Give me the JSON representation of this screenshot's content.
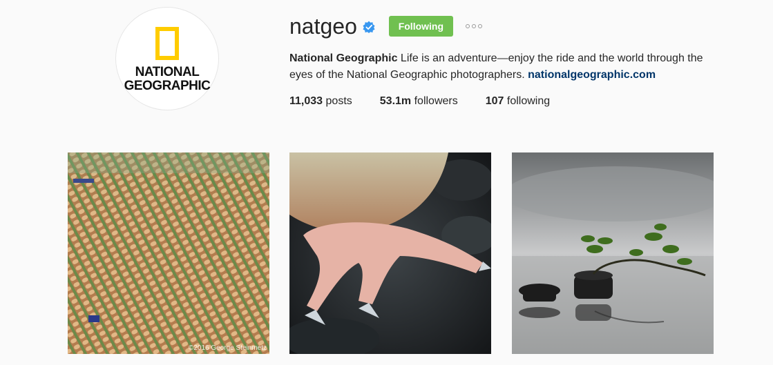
{
  "profile": {
    "username": "natgeo",
    "verified_icon": "verified-badge-icon",
    "follow_button_label": "Following",
    "follow_button_color": "#70c050",
    "avatar_logo_text_line1": "NATIONAL",
    "avatar_logo_text_line2": "GEOGRAPHIC",
    "brand_color": "#ffcc00"
  },
  "bio": {
    "full_name": "National Geographic",
    "text": "Life is an adventure—enjoy the ride and the world through the eyes of the National Geographic photographers.",
    "link": "nationalgeographic.com",
    "link_color": "#003569"
  },
  "stats": {
    "posts_count": "11,033",
    "posts_label": "posts",
    "followers_count": "53.1m",
    "followers_label": "followers",
    "following_count": "107",
    "following_label": "following"
  },
  "posts": [
    {
      "credit": "©2016 George Steinmetz"
    },
    {
      "credit": ""
    },
    {
      "credit": ""
    }
  ]
}
